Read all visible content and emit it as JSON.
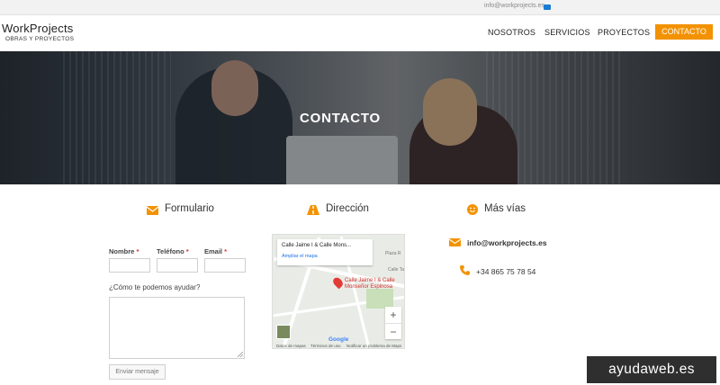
{
  "topbar": {
    "email": "info@workprojects.es",
    "icon": "mail-icon"
  },
  "brand": {
    "name": "WorkProjects",
    "tagline": "OBRAS Y PROYECTOS"
  },
  "nav": {
    "items": [
      {
        "label": "NOSOTROS"
      },
      {
        "label": "SERVICIOS"
      },
      {
        "label": "PROYECTOS"
      }
    ],
    "cta": "CONTACTO",
    "accent": "#f39200"
  },
  "hero": {
    "title": "CONTACTO"
  },
  "columns": {
    "form": {
      "title": "Formulario",
      "icon": "envelope-icon"
    },
    "address": {
      "title": "Dirección",
      "icon": "road-icon"
    },
    "more": {
      "title": "Más vías",
      "icon": "smile-icon"
    }
  },
  "form": {
    "fields": [
      {
        "label": "Nombre",
        "required": "*"
      },
      {
        "label": "Teléfono",
        "required": "*"
      },
      {
        "label": "Email",
        "required": "*"
      }
    ],
    "question": "¿Cómo te podemos ayudar?",
    "submit": "Enviar mensaje"
  },
  "map": {
    "card_title": "Calle Jaime I & Calle Mons...",
    "card_link": "Ampliar el mapa",
    "pin_label_1": "Calle Jaime I & Calle",
    "pin_label_2": "Monseñor Espinosa",
    "place_1": "Plaza R",
    "place_2": "Calle Ta",
    "brand": "Google",
    "zoom_in": "+",
    "zoom_out": "−",
    "attr_1": "Datos de mapas",
    "attr_2": "Términos de uso",
    "attr_3": "Notificar un problema de Maps"
  },
  "contact": {
    "email": "info@workprojects.es",
    "phone": "+34 865 75 78 54"
  },
  "watermark": "ayudaweb.es"
}
